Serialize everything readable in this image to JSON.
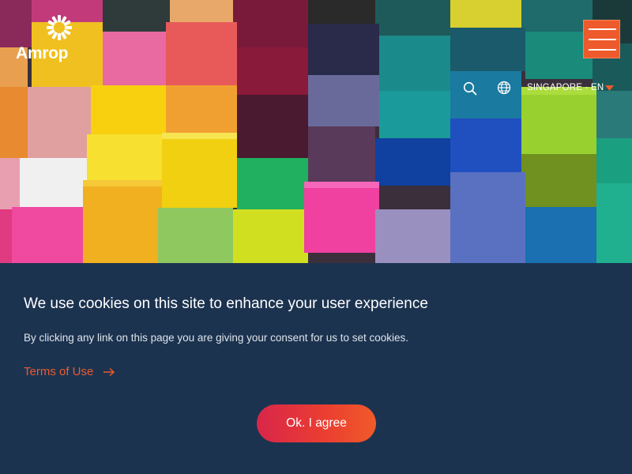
{
  "header": {
    "logo_text": "Amrop",
    "region_label": "SINGAPORE - EN",
    "icons": {
      "search": "search-icon",
      "language": "globe-icon",
      "dropdown": "caret-down-icon",
      "menu": "hamburger-menu-icon"
    },
    "colors": {
      "accent": "#ee5a2c",
      "text": "#ffffff"
    }
  },
  "cookie_banner": {
    "title": "We use cookies on this site to enhance your user experience",
    "text": "By clicking any link on this page you are giving your consent for us to set cookies.",
    "terms_label": "Terms of Use",
    "agree_label": "Ok. I agree",
    "colors": {
      "background": "#1c3350",
      "link": "#ee5a2c",
      "button_start": "#d8264a",
      "button_end": "#f05a28"
    }
  }
}
